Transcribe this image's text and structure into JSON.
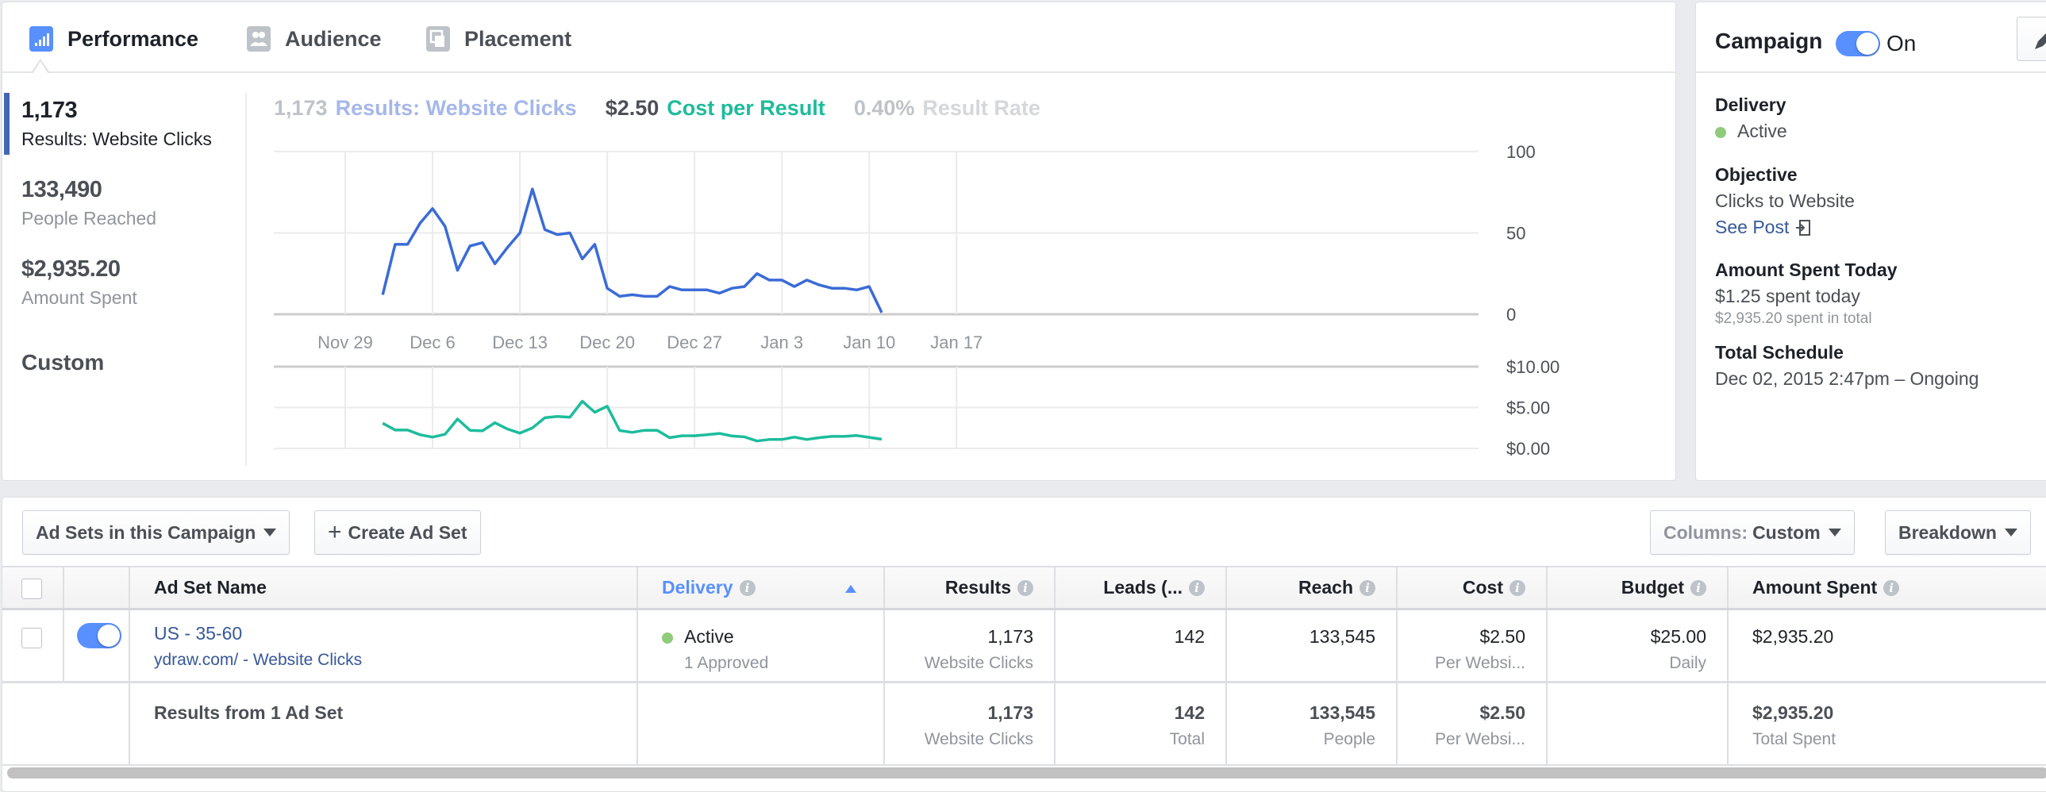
{
  "tabs": [
    {
      "label": "Performance",
      "icon": "bar-chart-icon",
      "active": true
    },
    {
      "label": "Audience",
      "icon": "people-icon",
      "active": false
    },
    {
      "label": "Placement",
      "icon": "placement-icon",
      "active": false
    }
  ],
  "metrics": [
    {
      "value": "1,173",
      "label": "Results: Website Clicks",
      "active": true
    },
    {
      "value": "133,490",
      "label": "People Reached",
      "active": false
    },
    {
      "value": "$2,935.20",
      "label": "Amount Spent",
      "active": false
    }
  ],
  "custom_label": "Custom",
  "summary": {
    "results_value": "1,173",
    "results_label": "Results: Website Clicks",
    "cost_value": "$2.50",
    "cost_label": "Cost per Result",
    "rate_value": "0.40%",
    "rate_label": "Result Rate"
  },
  "colors": {
    "results_line": "#3b6bd6",
    "cost_line": "#1dbc9c",
    "accent": "#5890ff",
    "link": "#365899",
    "active_dot": "#8fcb7b"
  },
  "chart_data": [
    {
      "type": "line",
      "title": "Results: Website Clicks",
      "x_ticks": [
        "Nov 29",
        "Dec 6",
        "Dec 13",
        "Dec 20",
        "Dec 27",
        "Jan 3",
        "Jan 10",
        "Jan 17"
      ],
      "x_start": "Nov 29",
      "x_days_span": 49,
      "ylim": [
        0,
        100
      ],
      "y_ticks": [
        "0",
        "50",
        "100"
      ],
      "y_tick_values": [
        0,
        50,
        100
      ],
      "y_axis_side": "right",
      "grid": true,
      "series": [
        {
          "name": "Results",
          "start_day_offset": 3,
          "values": [
            12,
            43,
            43,
            56,
            65,
            54,
            27,
            42,
            44,
            31,
            41,
            50,
            77,
            52,
            49,
            50,
            34,
            43,
            16,
            11,
            12,
            11,
            11,
            17,
            15,
            15,
            15,
            13,
            16,
            17,
            25,
            21,
            21,
            17,
            21,
            18,
            16,
            16,
            15,
            17,
            1
          ]
        }
      ]
    },
    {
      "type": "line",
      "title": "Cost per Result",
      "x_ticks": [
        "Nov 29",
        "Dec 6",
        "Dec 13",
        "Dec 20",
        "Dec 27",
        "Jan 3",
        "Jan 10",
        "Jan 17"
      ],
      "x_start": "Nov 29",
      "x_days_span": 49,
      "ylim": [
        0,
        10
      ],
      "y_ticks": [
        "$0.00",
        "$5.00",
        "$10.00"
      ],
      "y_tick_values": [
        0,
        5,
        10
      ],
      "y_axis_side": "right",
      "grid": true,
      "series": [
        {
          "name": "Cost per Result",
          "start_day_offset": 3,
          "values": [
            3.08,
            2.24,
            2.24,
            1.67,
            1.38,
            1.73,
            3.59,
            2.21,
            2.15,
            3.14,
            2.37,
            1.86,
            2.5,
            3.75,
            3.91,
            3.81,
            5.77,
            4.42,
            5.16,
            2.18,
            1.96,
            2.21,
            2.21,
            1.31,
            1.54,
            1.54,
            1.67,
            1.83,
            1.51,
            1.41,
            0.9,
            1.09,
            1.09,
            1.38,
            1.09,
            1.31,
            1.47,
            1.47,
            1.57,
            1.35,
            1.12
          ]
        }
      ]
    }
  ],
  "campaign": {
    "title": "Campaign",
    "toggle_label": "On",
    "edit_icon": "pencil-icon",
    "delivery_heading": "Delivery",
    "delivery_value": "Active",
    "objective_heading": "Objective",
    "objective_value": "Clicks to Website",
    "see_post_label": "See Post",
    "spent_heading": "Amount Spent Today",
    "spent_today": "$1.25 spent today",
    "spent_total": "$2,935.20 spent in total",
    "schedule_heading": "Total Schedule",
    "schedule_value": "Dec 02, 2015 2:47pm – Ongoing"
  },
  "toolbar": {
    "adsets_dropdown": "Ad Sets in this Campaign",
    "create_label": "Create Ad Set",
    "columns_prefix": "Columns:",
    "columns_value": "Custom",
    "breakdown_label": "Breakdown"
  },
  "table": {
    "headers": {
      "name": "Ad Set Name",
      "delivery": "Delivery",
      "results": "Results",
      "leads": "Leads (...",
      "reach": "Reach",
      "cost": "Cost",
      "budget": "Budget",
      "amount_spent": "Amount Spent"
    },
    "rows": [
      {
        "name": "US - 35-60",
        "sub_name": "ydraw.com/ - Website Clicks",
        "delivery": "Active",
        "delivery_sub": "1 Approved",
        "results": "1,173",
        "results_sub": "Website Clicks",
        "leads": "142",
        "reach": "133,545",
        "cost": "$2.50",
        "cost_sub": "Per Websi...",
        "budget": "$25.00",
        "budget_sub": "Daily",
        "amount_spent": "$2,935.20"
      }
    ],
    "totals": {
      "label": "Results from 1 Ad Set",
      "results": "1,173",
      "results_sub": "Website Clicks",
      "leads": "142",
      "leads_sub": "Total",
      "reach": "133,545",
      "reach_sub": "People",
      "cost": "$2.50",
      "cost_sub": "Per Websi...",
      "amount_spent": "$2,935.20",
      "amount_spent_sub": "Total Spent"
    }
  }
}
